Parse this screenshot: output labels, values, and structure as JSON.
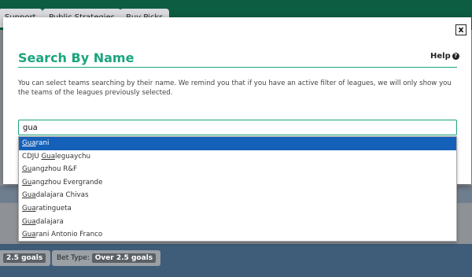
{
  "background": {
    "tabs": [
      "Support",
      "Public Strategies",
      "Buy Picks"
    ],
    "pill1": {
      "tag": "2.5 goals"
    },
    "pill2": {
      "label": "Bet Type:",
      "tag": "Over 2.5 goals"
    }
  },
  "modal": {
    "close_label": "x",
    "title": "Search By Name",
    "help_label": "Help",
    "help_icon": "?",
    "description": "You can select teams searching by their name. We remind you that if you have an active filter of leagues, we will only show you the teams of the leagues previously selected.",
    "search_value": "gua",
    "options": [
      {
        "pre": "",
        "match": "Gua",
        "post": "rani",
        "selected": true
      },
      {
        "pre": "CDJU ",
        "match": "Gua",
        "post": "leguaychu"
      },
      {
        "pre": "",
        "match": "Gu",
        "post": "angzhou R&F"
      },
      {
        "pre": "",
        "match": "Gu",
        "post": "angzhou Evergrande"
      },
      {
        "pre": "",
        "match": "Gua",
        "post": "dalajara Chivas"
      },
      {
        "pre": "",
        "match": "Gua",
        "post": "ratingueta"
      },
      {
        "pre": "",
        "match": "Gua",
        "post": "dalajara"
      },
      {
        "pre": "",
        "match": "Gua",
        "post": "rani Antonio Franco"
      }
    ]
  },
  "colors": {
    "accent": "#1aa57e",
    "selected": "#1560b8",
    "topbar": "#0d5d43"
  }
}
